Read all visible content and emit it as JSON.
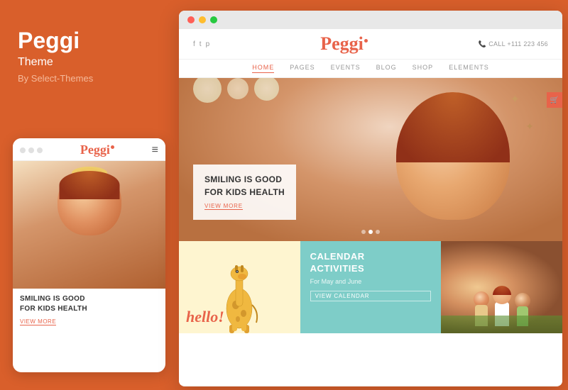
{
  "left": {
    "theme_title_line1": "Peggi",
    "theme_title_line2": "Theme",
    "by_line": "By Select-Themes"
  },
  "mobile": {
    "logo": "Peggi",
    "hero_caption": "SMILING IS GOOD\nFOR KIDS HEALTH",
    "view_more": "VIEW MORE"
  },
  "desktop": {
    "social_icons": [
      "f",
      "t",
      "p"
    ],
    "logo": "Peggi",
    "call_label": "CALL",
    "phone": "+111 223 456",
    "nav_items": [
      "HOME",
      "PAGES",
      "EVENTS",
      "BLOG",
      "SHOP",
      "ELEMENTS"
    ],
    "active_nav": "HOME",
    "hero_title": "SMILING IS GOOD\nFOR KIDS HEALTH",
    "hero_link": "VIEW MORE",
    "cards": [
      {
        "type": "illustration",
        "hello_text": "hello!"
      },
      {
        "type": "teal",
        "title": "CALENDAR ACTIVITIES",
        "subtitle": "For May and June",
        "link": "VIEW CALENDAR"
      },
      {
        "type": "photo",
        "alt": "children playing"
      }
    ]
  }
}
